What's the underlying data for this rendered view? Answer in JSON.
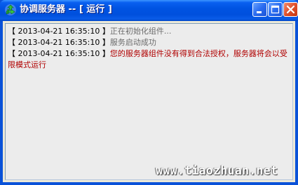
{
  "window": {
    "title": "协调服务器 -- [ 运行 ]"
  },
  "log": {
    "entries": [
      {
        "open": "【",
        "timestamp": "2013-04-21 16:35:10",
        "close": "】",
        "message": "正在初始化组件..."
      },
      {
        "open": "【",
        "timestamp": "2013-04-21 16:35:10",
        "close": "】",
        "message": "服务启动成功"
      },
      {
        "open": "【",
        "timestamp": "2013-04-21 16:35:10",
        "close": "】",
        "message": "您的服务器组件没有得到合法授权，服务器将会以受限模式运行"
      }
    ]
  },
  "watermark": {
    "text": "www.tiaozhuan.net"
  },
  "colors": {
    "titlebar": "#0053e2",
    "message_gray": "#6b6b6b",
    "message_red": "#b00000",
    "close_button": "#e0502c"
  },
  "icons": {
    "app": "recycle-arrows-icon",
    "minimize": "minimize-icon",
    "maximize": "maximize-icon",
    "close": "close-icon"
  }
}
